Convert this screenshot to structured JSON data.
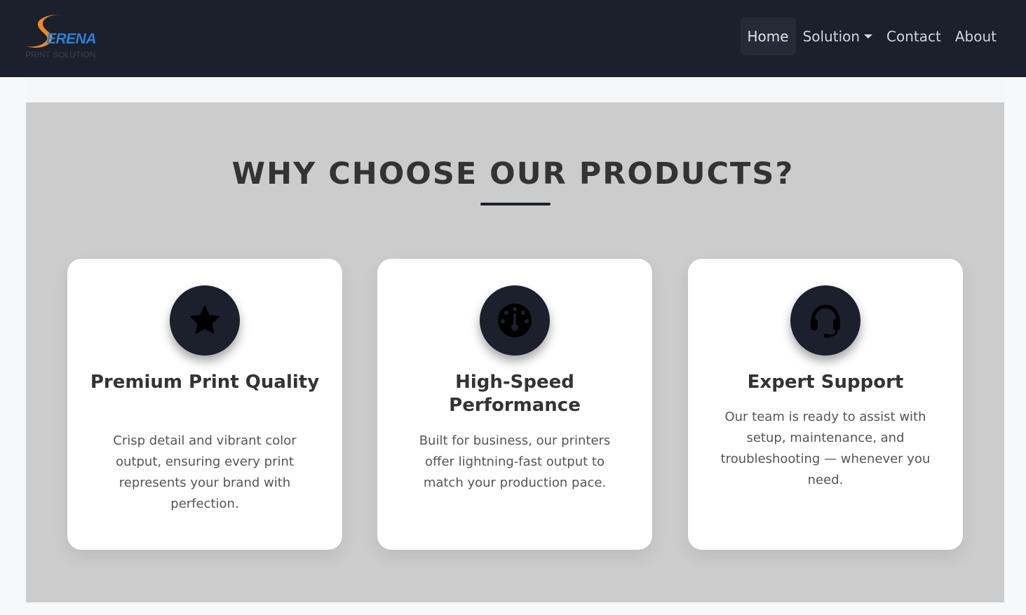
{
  "brand": {
    "logo_word": "ERENA",
    "logo_sub": "PRINT SOLUTION"
  },
  "nav": {
    "home": "Home",
    "solution": "Solution",
    "contact": "Contact",
    "about": "About"
  },
  "section": {
    "title": "WHY CHOOSE OUR PRODUCTS?"
  },
  "features": [
    {
      "icon": "star-icon",
      "title": "Premium Print Quality",
      "text": "Crisp detail and vibrant color output, ensuring every print represents your brand with perfection."
    },
    {
      "icon": "gauge-icon",
      "title": "High-Speed Performance",
      "text": "Built for business, our printers offer lightning-fast output to match your production pace."
    },
    {
      "icon": "headset-icon",
      "title": "Expert Support",
      "text": "Our team is ready to assist with setup, maintenance, and troubleshooting — whenever you need."
    }
  ],
  "colors": {
    "navbar": "#1c1f2c",
    "section_bg": "#cccccc",
    "brand_orange": "#f08a24",
    "brand_blue": "#2d7fd6"
  }
}
